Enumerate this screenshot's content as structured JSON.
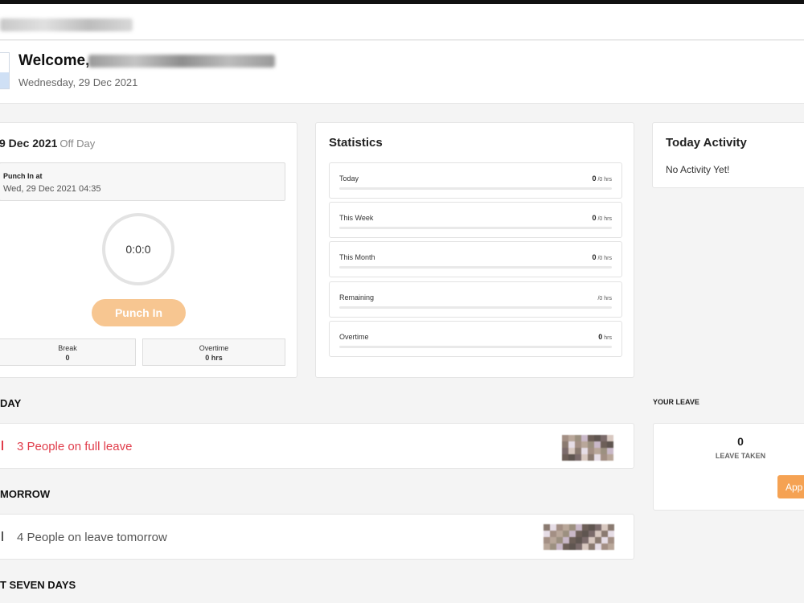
{
  "header": {
    "welcome": "Welcome,",
    "date": "Wednesday, 29 Dec 2021"
  },
  "punch": {
    "date": "9 Dec 2021",
    "status": "Off Day",
    "punch_in_label": "Punch In at",
    "punch_in_value": "Wed, 29 Dec 2021 04:35",
    "timer": "0:0:0",
    "button": "Punch In",
    "break_label": "Break",
    "break_value": "0",
    "overtime_label": "Overtime",
    "overtime_value": "0 hrs"
  },
  "statistics": {
    "title": "Statistics",
    "rows": [
      {
        "label": "Today",
        "value": "0",
        "unit": "/0 hrs",
        "progress": 0
      },
      {
        "label": "This Week",
        "value": "0",
        "unit": "/0 hrs",
        "progress": 0
      },
      {
        "label": "This Month",
        "value": "0",
        "unit": "/0 hrs",
        "progress": 0
      },
      {
        "label": "Remaining",
        "value": "",
        "unit": "/0 hrs",
        "progress": 0
      },
      {
        "label": "Overtime",
        "value": "0",
        "unit": "hrs",
        "progress": 0
      }
    ]
  },
  "activity": {
    "title": "Today Activity",
    "empty": "No Activity Yet!"
  },
  "leave_sections": [
    {
      "heading": "DAY",
      "text": "3 People on full leave",
      "color": "#e03c4a"
    },
    {
      "heading": "MORROW",
      "text": "4 People on leave tomorrow",
      "color": "#555555"
    },
    {
      "heading": "T SEVEN DAYS"
    }
  ],
  "your_leave": {
    "heading": "YOUR LEAVE",
    "count": "0",
    "label": "LEAVE TAKEN",
    "button": "App"
  }
}
